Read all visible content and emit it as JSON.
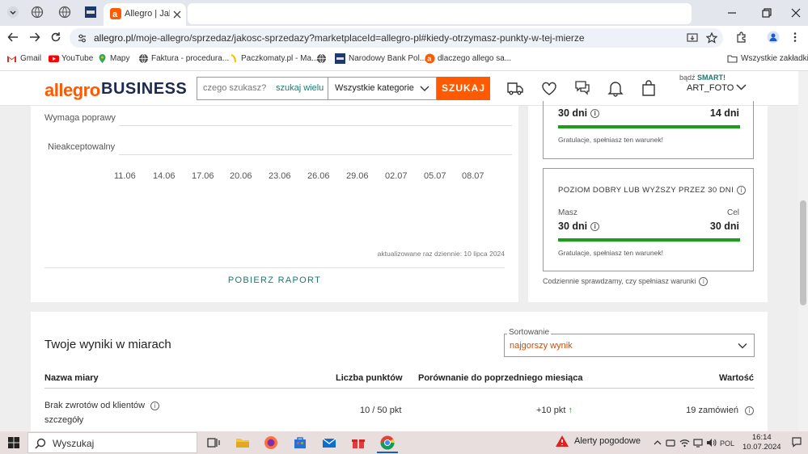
{
  "browser": {
    "active_tab_title": "Allegro | Jakość",
    "url_host": "allegro.pl",
    "url_path": "/moje-allegro/sprzedaz/jakosc-sprzedazy?marketplaceId=allegro-pl#kiedy-otrzymasz-punkty-w-tej-mierze"
  },
  "bookmarks": [
    {
      "label": "Gmail",
      "icon": "gmail-icon"
    },
    {
      "label": "YouTube",
      "icon": "youtube-icon"
    },
    {
      "label": "Mapy",
      "icon": "maps-icon"
    },
    {
      "label": "Faktura - procedura...",
      "icon": "globe-icon"
    },
    {
      "label": "Paczkomaty.pl - Ma...",
      "icon": "paczkomaty-icon"
    },
    {
      "label": "Narodowy Bank Pol...",
      "icon": "nbp-icon"
    },
    {
      "label": "dlaczego allego sa...",
      "icon": "allegro-icon"
    }
  ],
  "bookmarks_all": "Wszystkie zakładki",
  "header": {
    "logo_allegro": "allegro",
    "logo_business": "BUSINESS",
    "search_placeholder": "czego szukasz?",
    "search_many": "szukaj wielu",
    "category": "Wszystkie kategorie",
    "search_button": "SZUKAJ",
    "smart_prefix": "bądź",
    "smart_label": "SMART!",
    "user": "ART_FOTO"
  },
  "chart": {
    "y_levels": [
      "Wymaga poprawy",
      "Nieakceptowalny"
    ],
    "x_ticks": [
      "11.06",
      "14.06",
      "17.06",
      "20.06",
      "23.06",
      "26.06",
      "29.06",
      "02.07",
      "05.07",
      "08.07"
    ],
    "updated_note": "aktualizowane raz dziennie: 10 lipca 2024",
    "report_button": "POBIERZ RAPORT"
  },
  "goals": {
    "box1": {
      "have": "30 dni",
      "target": "14 dni",
      "progress_pct": 100,
      "message": "Gratulacje, spełniasz ten warunek!"
    },
    "box2": {
      "title": "POZIOM DOBRY LUB WYŻSZY PRZEZ 30 DNI",
      "have_label": "Masz",
      "target_label": "Cel",
      "have": "30 dni",
      "target": "30 dni",
      "progress_pct": 100,
      "message": "Gratulacje, spełniasz ten warunek!"
    },
    "daily_note": "Codziennie sprawdzamy, czy spełniasz warunki"
  },
  "results": {
    "title": "Twoje wyniki w miarach",
    "sort_legend": "Sortowanie",
    "sort_value": "najgorszy wynik",
    "columns": [
      "Nazwa miary",
      "Liczba punktów",
      "Porównanie do poprzedniego miesiąca",
      "Wartość"
    ],
    "rows": [
      {
        "name": "Brak zwrotów od klientów",
        "link": "szczegóły",
        "points": "10 / 50 pkt",
        "change": "+10 pkt",
        "value": "19 zamówień"
      }
    ]
  },
  "taskbar": {
    "search": "Wyszukaj",
    "weather": "Alerty pogodowe",
    "time": "16:14",
    "date": "10.07.2024"
  }
}
